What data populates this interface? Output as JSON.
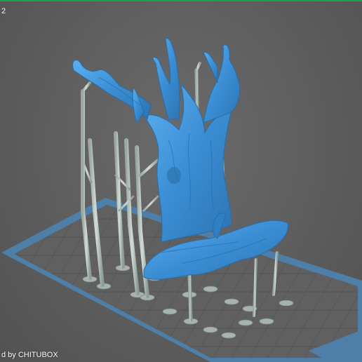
{
  "viewport": {
    "corner_text": "2",
    "watermark_text": "d by CHITUBOX"
  },
  "colors": {
    "background": "#5d5d5d",
    "build_plate": "#4f86b5",
    "plate_inner": "#5f5f5f",
    "supports": "#b9c5bf",
    "model": "#3f93d8",
    "accent": "#1fa14a"
  },
  "icons": {
    "model": "tree-model-icon",
    "plate": "build-plate-icon"
  }
}
